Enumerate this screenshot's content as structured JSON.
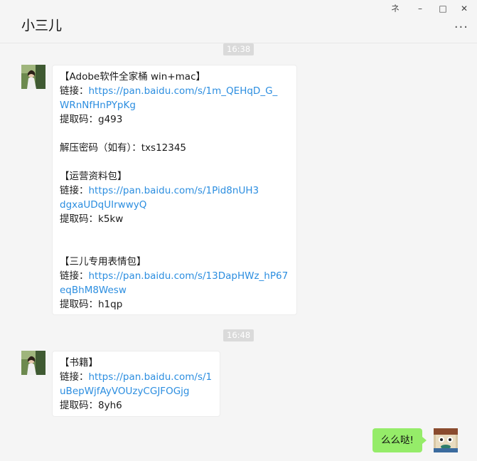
{
  "window": {
    "title": "小三儿",
    "controls": {
      "pin": "ネ",
      "minimize": "–",
      "maximize": "□",
      "close": "✕"
    },
    "more": "···"
  },
  "timestamps": [
    "16:38",
    "16:48"
  ],
  "messages": {
    "m1": {
      "lines": [
        "【Adobe软件全家桶 win+mac】",
        "链接：",
        "https://pan.baidu.com/s/1m_QEHqD_G_",
        "WRnNfHnPYpKg",
        "提取码：g493",
        "解压密码（如有）：txs12345",
        "【运营资料包】",
        "链接：",
        "https://pan.baidu.com/s/1Pid8nUH3",
        "dgxaUDqUIrwwyQ",
        "提取码：k5kw",
        "【三儿专用表情包】",
        "链接：",
        "https://pan.baidu.com/s/13DapHWz_hP67",
        "eqBhM8Wesw",
        "提取码：h1qp"
      ]
    },
    "m2": {
      "lines": [
        "【书籍】",
        "链接：",
        "https://pan.baidu.com/s/1",
        "uBepWjfAyVOUzyCGJFOGjg",
        "提取码：8yh6"
      ]
    },
    "m3": {
      "text": "么么哒!"
    }
  },
  "colors": {
    "link": "#2c8ee0",
    "outgoing_bubble": "#95ec69",
    "timestamp_bg": "#dadada"
  }
}
